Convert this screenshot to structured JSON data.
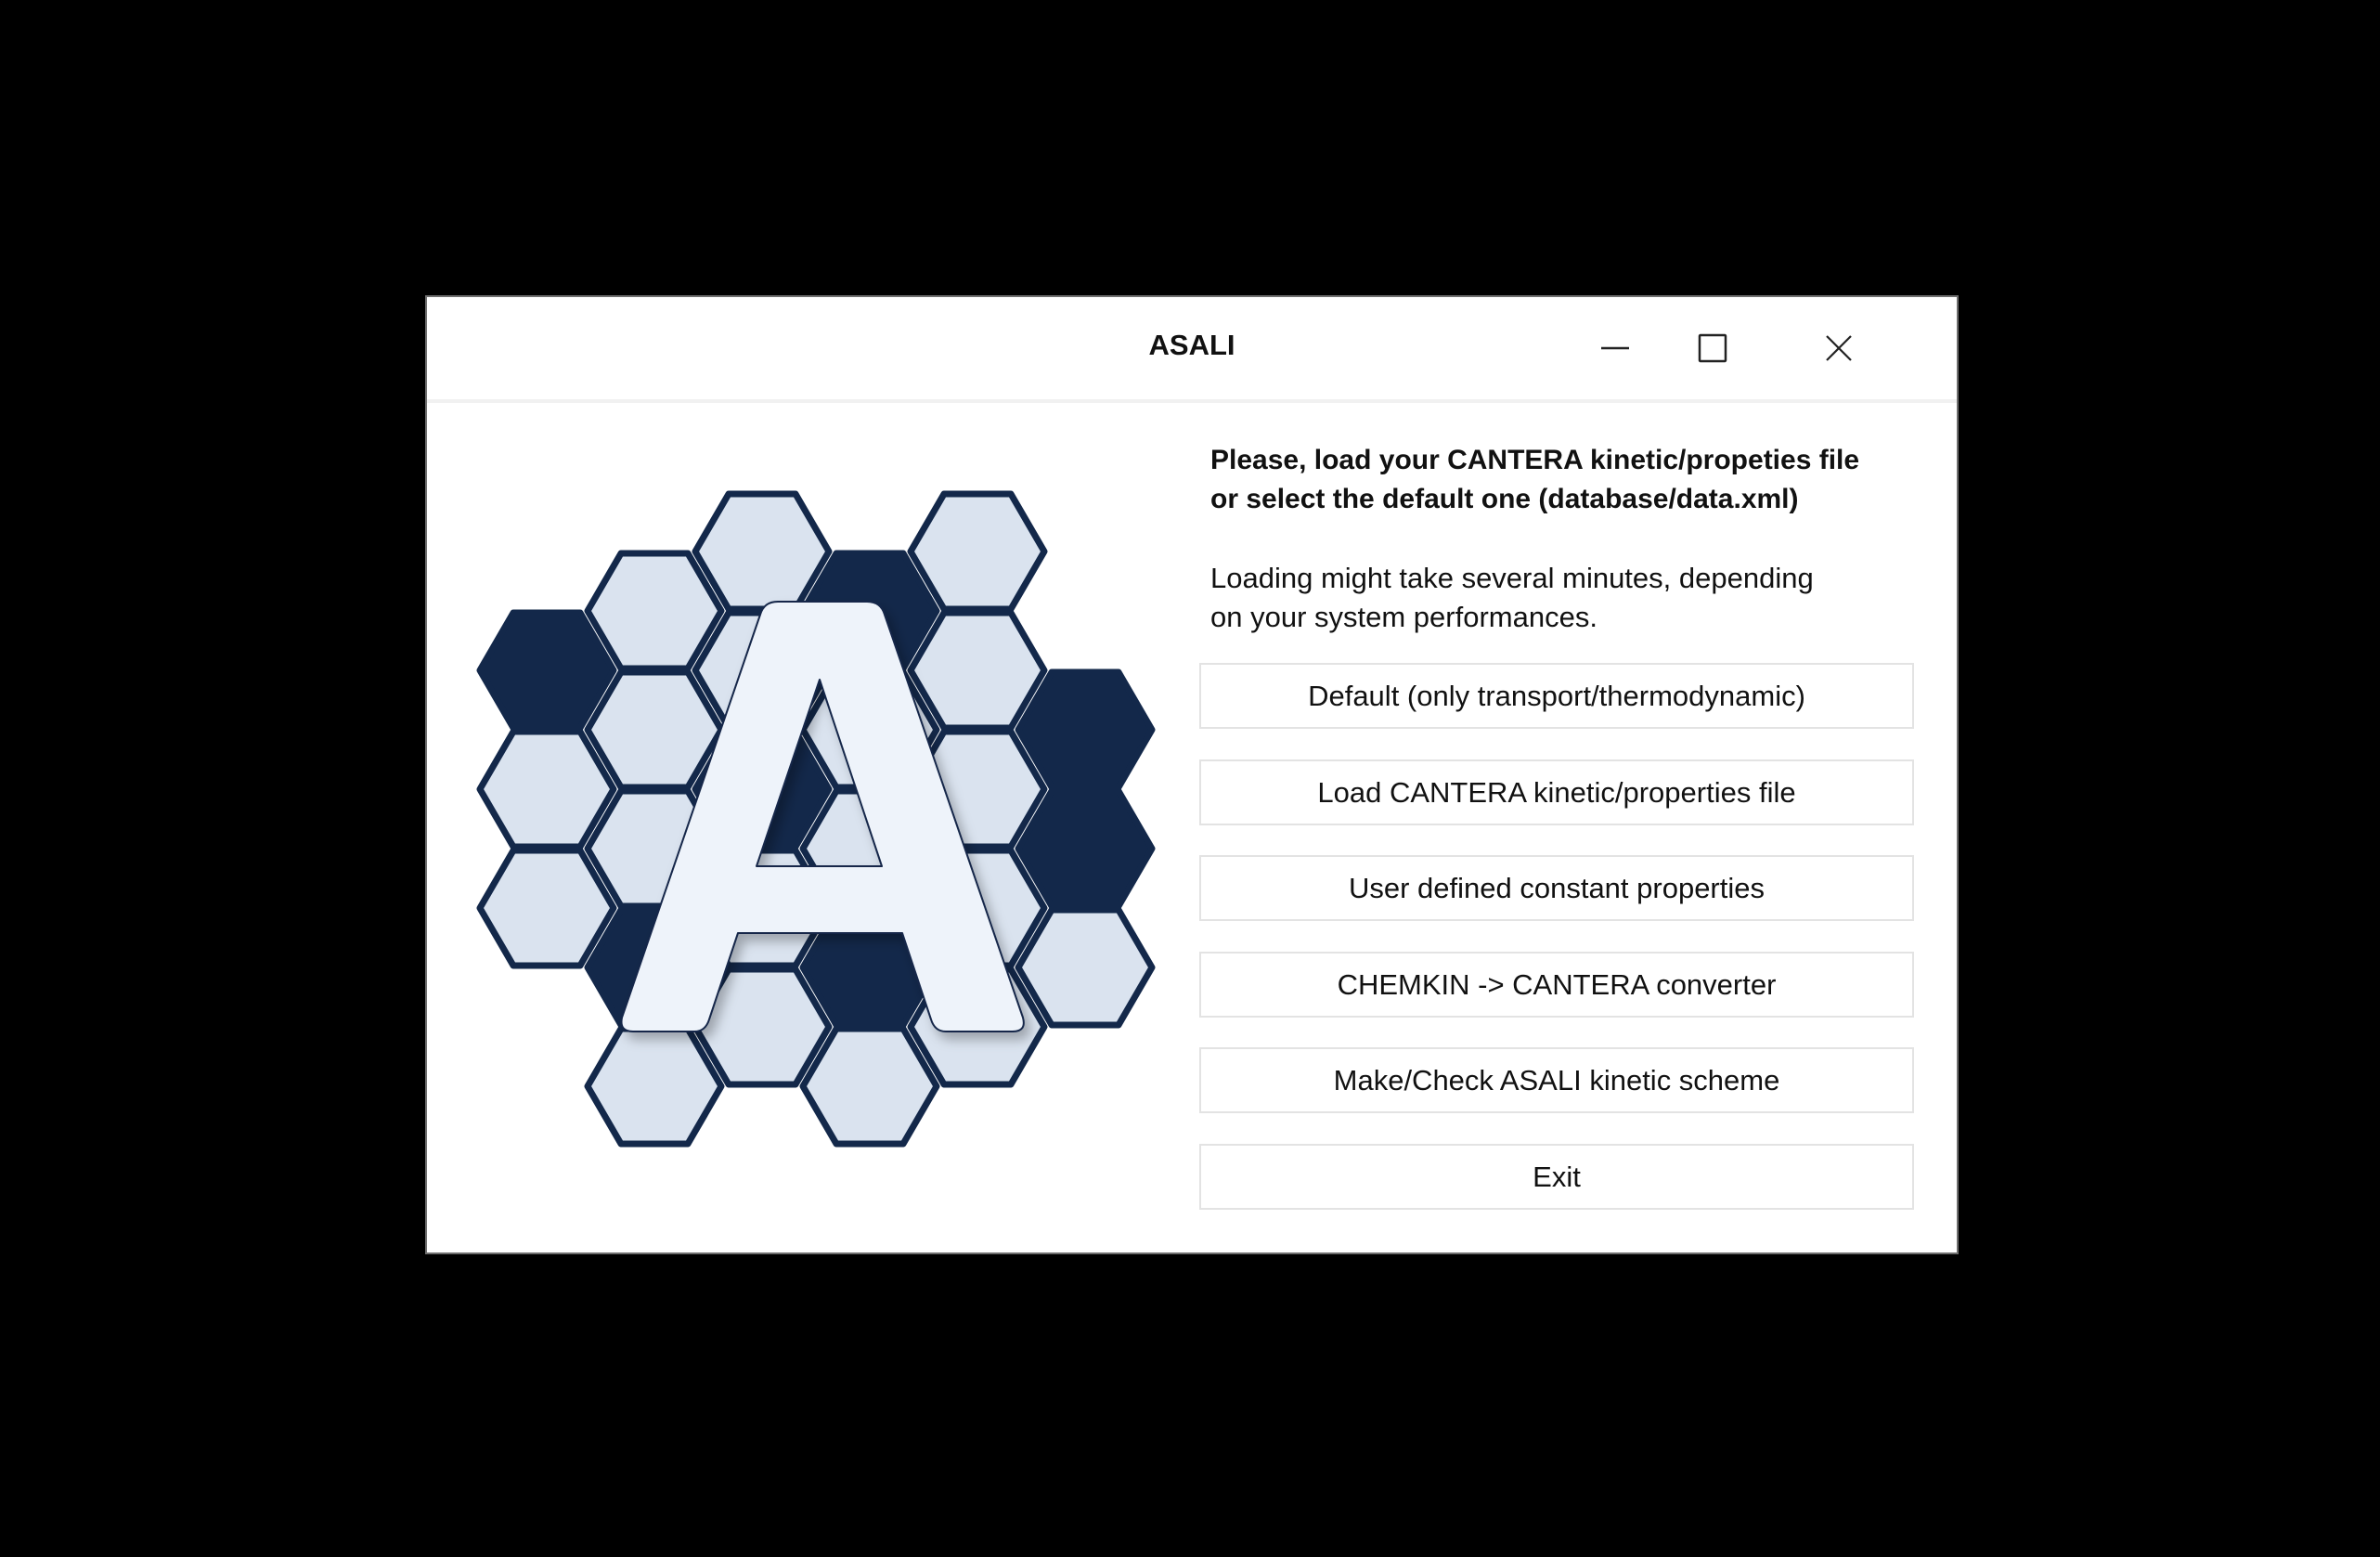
{
  "window": {
    "title": "ASALI",
    "controls": {
      "minimize": "minimize-icon",
      "maximize": "maximize-icon",
      "close": "close-icon"
    }
  },
  "logo": {
    "letter": "A",
    "colors": {
      "dark": "#13284a",
      "light": "#dae3ef",
      "letter_fill": "#eef3fa",
      "stroke": "#13284a"
    },
    "hexagons": [
      {
        "col": 0,
        "row": 1,
        "tone": "dark"
      },
      {
        "col": 0,
        "row": 2,
        "tone": "light"
      },
      {
        "col": 0,
        "row": 3,
        "tone": "light"
      },
      {
        "col": 1,
        "row": 0,
        "tone": "light"
      },
      {
        "col": 1,
        "row": 1,
        "tone": "light"
      },
      {
        "col": 1,
        "row": 2,
        "tone": "light"
      },
      {
        "col": 1,
        "row": 3,
        "tone": "dark"
      },
      {
        "col": 1,
        "row": 4,
        "tone": "light"
      },
      {
        "col": 2,
        "row": 0,
        "tone": "light"
      },
      {
        "col": 2,
        "row": 1,
        "tone": "light"
      },
      {
        "col": 2,
        "row": 2,
        "tone": "dark"
      },
      {
        "col": 2,
        "row": 3,
        "tone": "light"
      },
      {
        "col": 2,
        "row": 4,
        "tone": "light"
      },
      {
        "col": 3,
        "row": 0,
        "tone": "dark"
      },
      {
        "col": 3,
        "row": 1,
        "tone": "light"
      },
      {
        "col": 3,
        "row": 2,
        "tone": "light"
      },
      {
        "col": 3,
        "row": 3,
        "tone": "dark"
      },
      {
        "col": 3,
        "row": 4,
        "tone": "light"
      },
      {
        "col": 4,
        "row": 0,
        "tone": "light"
      },
      {
        "col": 4,
        "row": 1,
        "tone": "light"
      },
      {
        "col": 4,
        "row": 2,
        "tone": "light"
      },
      {
        "col": 4,
        "row": 3,
        "tone": "light"
      },
      {
        "col": 4,
        "row": 4,
        "tone": "light"
      },
      {
        "col": 5,
        "row": 1,
        "tone": "dark"
      },
      {
        "col": 5,
        "row": 2,
        "tone": "dark"
      },
      {
        "col": 5,
        "row": 3,
        "tone": "light"
      }
    ]
  },
  "panel": {
    "heading_lines": [
      "Please, load your CANTERA kinetic/propeties file",
      "or select the default one (database/data.xml)"
    ],
    "note_lines": [
      "Loading might take several minutes, depending",
      "on your system performances."
    ]
  },
  "buttons": [
    {
      "label": "Default (only transport/thermodynamic)"
    },
    {
      "label": "Load CANTERA kinetic/properties file"
    },
    {
      "label": "User defined constant properties"
    },
    {
      "label": "CHEMKIN -> CANTERA converter"
    },
    {
      "label": "Make/Check ASALI kinetic scheme"
    },
    {
      "label": "Exit"
    }
  ]
}
